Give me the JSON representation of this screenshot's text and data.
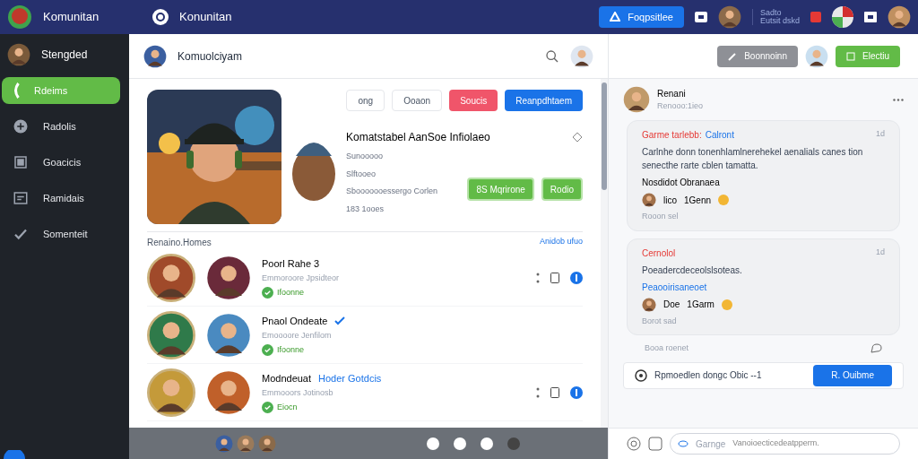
{
  "header": {
    "app_name": "Komunitan",
    "tab_title": "Konunitan",
    "primary_button": "Foqpsitlee",
    "status_lines": [
      "Sadto",
      "Eutsit dskd"
    ]
  },
  "sidebar": {
    "profile_name": "Stengded",
    "items": [
      {
        "label": "Rdeims",
        "selected": true
      },
      {
        "label": "Radolis",
        "selected": false
      },
      {
        "label": "Goacicis",
        "selected": false
      },
      {
        "label": "Ramidais",
        "selected": false
      },
      {
        "label": "Somenteit",
        "selected": false
      }
    ]
  },
  "main": {
    "title": "Komuolciyam",
    "toolbar_buttons": [
      {
        "label": "ong",
        "kind": "outline"
      },
      {
        "label": "Ooaon",
        "kind": "outline"
      },
      {
        "label": "Soucis",
        "kind": "danger"
      },
      {
        "label": "Reanpdhtaem",
        "kind": "primary"
      }
    ],
    "game": {
      "title": "Komatstabel AanSoe Infiolaeo",
      "lines": [
        "Sunooooo",
        "Slftooeo",
        "Sbooooooessergo Corlen",
        "183 1ooes"
      ],
      "buttons": [
        "8S Mqrirone",
        "Rodio"
      ]
    },
    "friends": {
      "heading": "Renaino.Homes",
      "link": "Anidob ufuo",
      "rows": [
        {
          "name": "Poorl Rahe 3",
          "subtitle": "Emmoroore Jpsidteor",
          "status": "Ifoonne",
          "verified": false,
          "actions": true
        },
        {
          "name": "Pnaol Ondeate",
          "subtitle": "Emoooore Jenfilom",
          "status": "Ifoonne",
          "verified": true,
          "actions": false
        },
        {
          "name": "Modndeuat",
          "tag": "Hoder Gotdcis",
          "subtitle": "Emmooors Jotinosb",
          "status": "Eiocn",
          "verified": false,
          "actions": true
        }
      ]
    }
  },
  "right": {
    "gray_button": "Boonnoinn",
    "green_button": "Electiu",
    "post": {
      "author": "Renani",
      "time": "Renooo:1ieo"
    },
    "comments": [
      {
        "author": "Garme tarlebb:",
        "link": "Calront",
        "time": "1d",
        "body": "Carlnhe donn tonenhlamlnerehekel aenalials canes tion senecthe rarte cblen tamatta.",
        "emphasis": "Nosdidot Obranaea",
        "reaction_name": "lico",
        "reaction_text": "1Genn",
        "footer": "Rooon sel"
      },
      {
        "author": "Cernolol",
        "time": "1d",
        "body": "Poeadercdeceolslsoteas.",
        "link_line": "Peaooirisaneoet",
        "reaction_name": "Doe",
        "reaction_text": "1Garm",
        "footer": "Borot sad"
      }
    ],
    "reply_hint": "Booa roenet",
    "suggestion": {
      "text": "Rpmoedlen dongc Obic --1",
      "button": "R. Ouibme"
    },
    "composer": {
      "label": "Garnge",
      "placeholder": "Vanoioecticedeatpperm."
    }
  }
}
